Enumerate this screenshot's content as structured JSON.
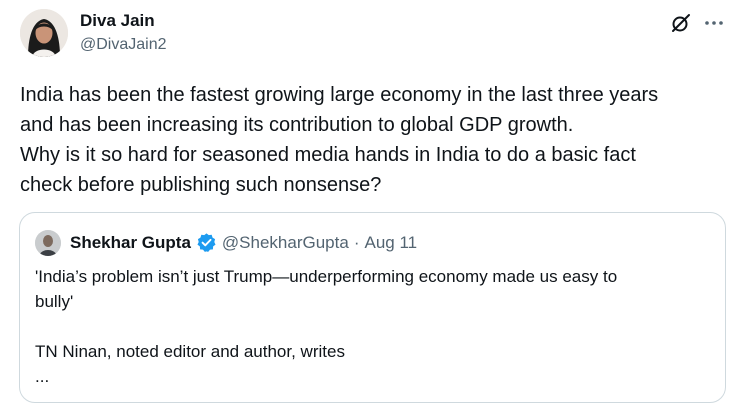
{
  "author": {
    "name": "Diva Jain",
    "handle": "@DivaJain2"
  },
  "actions": {
    "grok_icon": "grok-icon",
    "more_icon": "more-horizontal-icon"
  },
  "tweet": {
    "lines": [
      "India has been the fastest growing large economy in the last three years",
      "and has been increasing its contribution to global GDP growth.",
      "Why is it so hard for seasoned media hands in India to do a basic fact",
      "check before publishing such nonsense?"
    ]
  },
  "quote": {
    "name": "Shekhar Gupta",
    "handle": "@ShekharGupta",
    "separator": "·",
    "date": "Aug 11",
    "verified_color": "#1d9bf0",
    "lines": [
      "'India’s problem isn’t just Trump—underperforming economy made us easy to",
      "bully'",
      "",
      "TN Ninan, noted editor and author, writes",
      "..."
    ]
  },
  "colors": {
    "text_primary": "#0f1419",
    "text_secondary": "#536471",
    "border": "#cfd9de",
    "accent": "#1d9bf0"
  }
}
